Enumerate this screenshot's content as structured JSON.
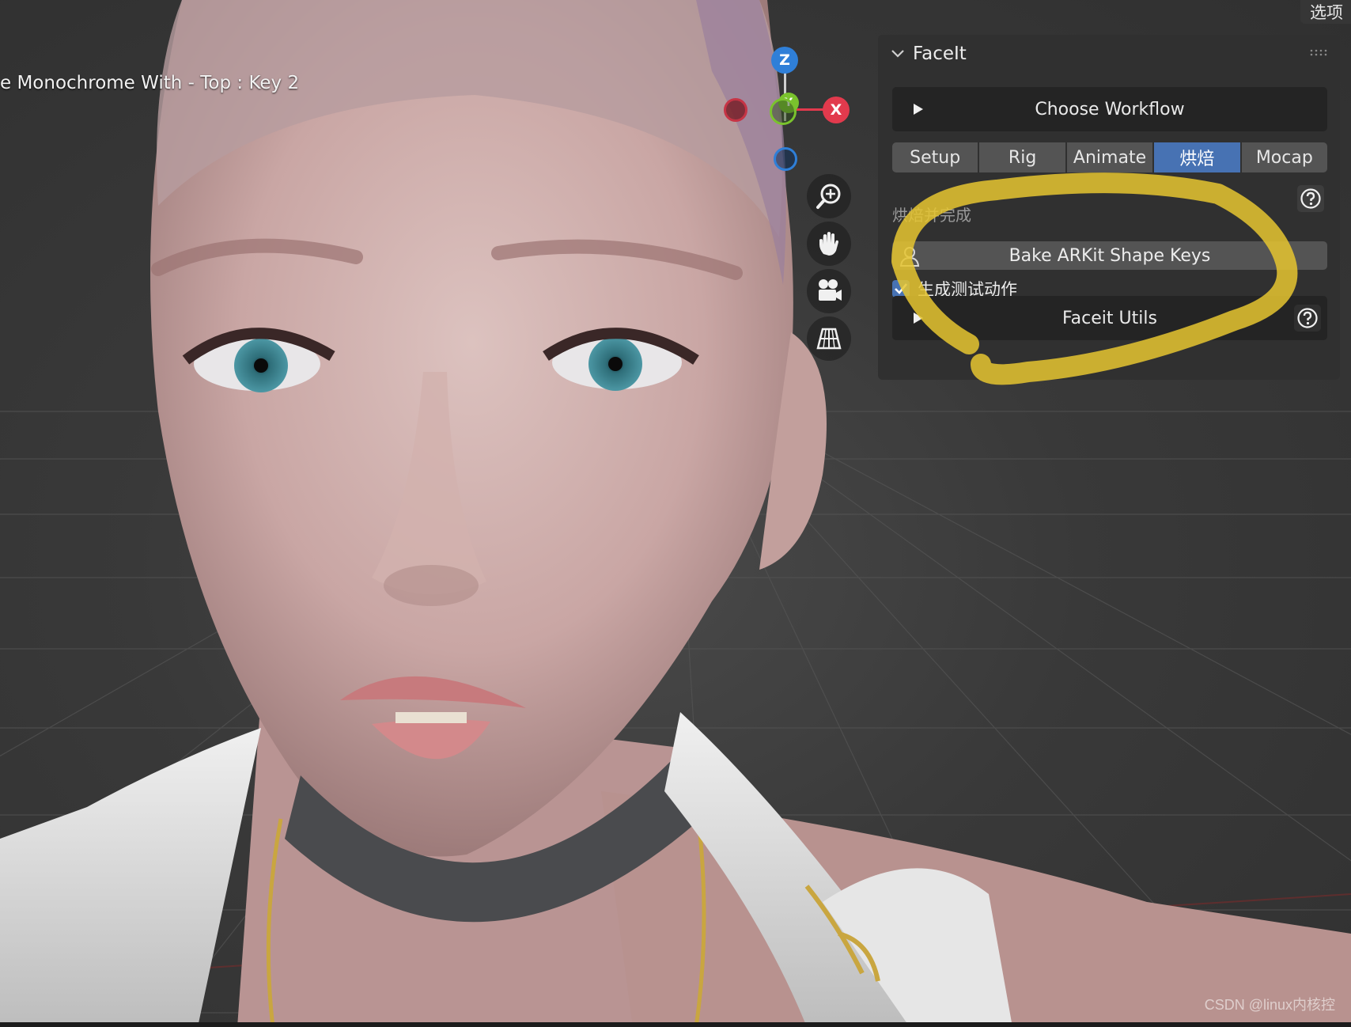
{
  "app": {
    "options_label": "选项"
  },
  "viewport": {
    "object_label": "e Monochrome With - Top : Key 2",
    "gizmo": {
      "x_label": "X",
      "y_label": "Y",
      "z_label": "Z",
      "x_color": "#e23a4d",
      "y_color": "#7ac32d",
      "z_color": "#2f7fd8"
    },
    "tools": [
      "zoom-icon",
      "pan-hand-icon",
      "camera-icon",
      "grid-perspective-icon"
    ]
  },
  "panel": {
    "title": "FaceIt",
    "choose_workflow_label": "Choose Workflow",
    "tabs": [
      {
        "label": "Setup",
        "active": false
      },
      {
        "label": "Rig",
        "active": false
      },
      {
        "label": "Animate",
        "active": false
      },
      {
        "label": "烘焙",
        "active": true
      },
      {
        "label": "Mocap",
        "active": false
      }
    ],
    "section_label": "烘焙并完成",
    "bake_button_label": "Bake ARKit Shape Keys",
    "checkbox_label": "生成测试动作",
    "checkbox_checked": true,
    "utils_label": "Faceit Utils",
    "accent_color": "#4772b3",
    "annotation_color": "#e6c630"
  },
  "watermark": "CSDN @linux内核控"
}
